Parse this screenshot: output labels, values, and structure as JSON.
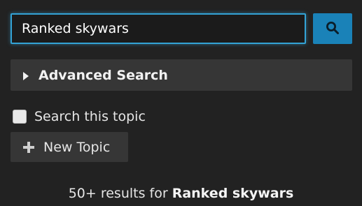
{
  "search": {
    "value": "Ranked skywars",
    "button_icon": "search-icon"
  },
  "advanced_search": {
    "label": "Advanced Search",
    "icon": "caret-right-icon"
  },
  "filter": {
    "search_this_topic_label": "Search this topic",
    "checked": false
  },
  "new_topic": {
    "label": "New Topic",
    "icon": "plus-icon"
  },
  "results": {
    "count_text": "50+ results for",
    "query": "Ranked skywars"
  },
  "colors": {
    "background": "#222222",
    "panel": "#363636",
    "accent": "#1a82b8",
    "focus_border": "#33a3d6"
  }
}
